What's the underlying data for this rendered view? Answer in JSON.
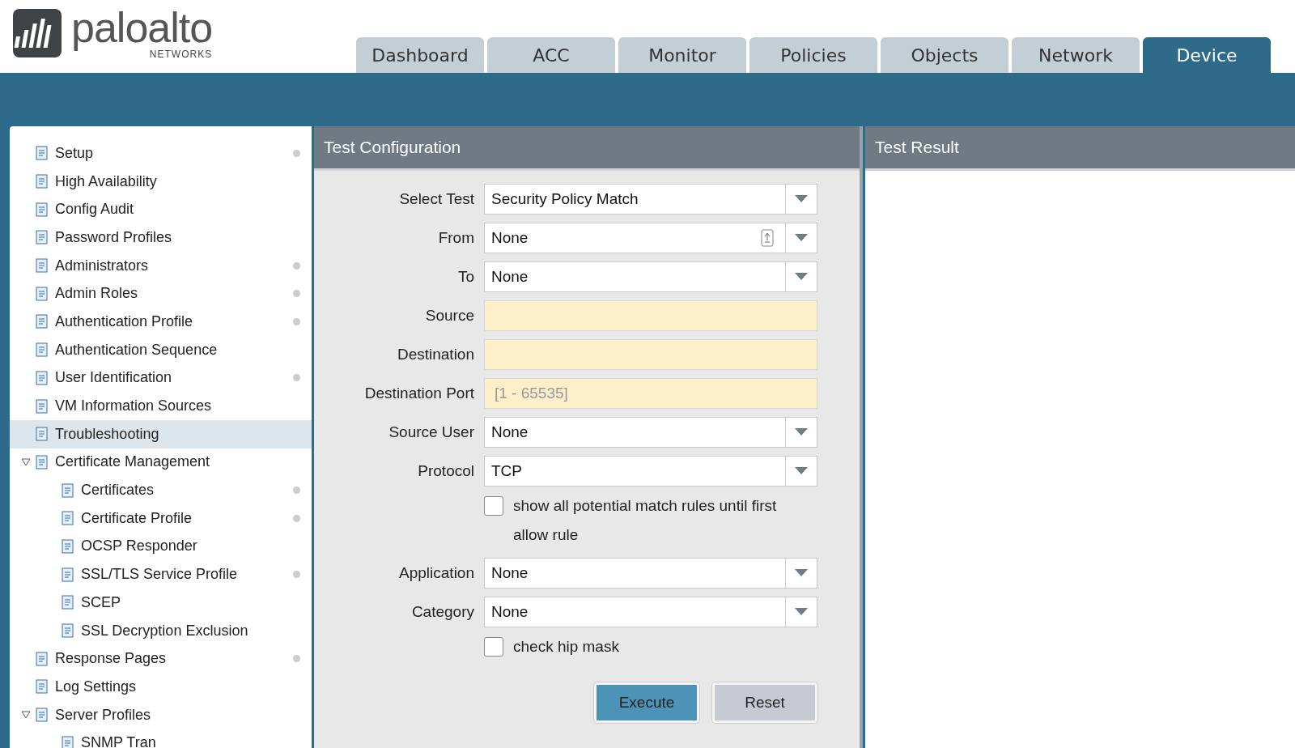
{
  "logo": {
    "wordmark": "paloalto",
    "subtitle": "NETWORKS"
  },
  "tabs": [
    {
      "label": "Dashboard",
      "selected": false
    },
    {
      "label": "ACC",
      "selected": false
    },
    {
      "label": "Monitor",
      "selected": false
    },
    {
      "label": "Policies",
      "selected": false
    },
    {
      "label": "Objects",
      "selected": false
    },
    {
      "label": "Network",
      "selected": false
    },
    {
      "label": "Device",
      "selected": true
    }
  ],
  "sidebar": {
    "items": [
      {
        "label": "Setup",
        "selected": false,
        "dot": true
      },
      {
        "label": "High Availability",
        "selected": false,
        "dot": false
      },
      {
        "label": "Config Audit",
        "selected": false,
        "dot": false
      },
      {
        "label": "Password Profiles",
        "selected": false,
        "dot": false
      },
      {
        "label": "Administrators",
        "selected": false,
        "dot": true
      },
      {
        "label": "Admin Roles",
        "selected": false,
        "dot": true
      },
      {
        "label": "Authentication Profile",
        "selected": false,
        "dot": true
      },
      {
        "label": "Authentication Sequence",
        "selected": false,
        "dot": false
      },
      {
        "label": "User Identification",
        "selected": false,
        "dot": true
      },
      {
        "label": "VM Information Sources",
        "selected": false,
        "dot": false
      },
      {
        "label": "Troubleshooting",
        "selected": true,
        "dot": false
      },
      {
        "label": "Certificate Management",
        "selected": false,
        "dot": false,
        "expanded": true,
        "children": [
          {
            "label": "Certificates",
            "selected": false,
            "dot": true
          },
          {
            "label": "Certificate Profile",
            "selected": false,
            "dot": true
          },
          {
            "label": "OCSP Responder",
            "selected": false,
            "dot": false
          },
          {
            "label": "SSL/TLS Service Profile",
            "selected": false,
            "dot": true
          },
          {
            "label": "SCEP",
            "selected": false,
            "dot": false
          },
          {
            "label": "SSL Decryption Exclusion",
            "selected": false,
            "dot": false
          }
        ]
      },
      {
        "label": "Response Pages",
        "selected": false,
        "dot": true
      },
      {
        "label": "Log Settings",
        "selected": false,
        "dot": false
      },
      {
        "label": "Server Profiles",
        "selected": false,
        "dot": false,
        "expanded": true,
        "children": [
          {
            "label": "SNMP Tran",
            "selected": false,
            "dot": false
          }
        ]
      }
    ]
  },
  "test_configuration": {
    "title": "Test Configuration",
    "fields": [
      {
        "kind": "select",
        "label": "Select Test",
        "value": "Security Policy Match",
        "picker": false
      },
      {
        "kind": "select",
        "label": "From",
        "value": "None",
        "picker": true
      },
      {
        "kind": "select",
        "label": "To",
        "value": "None",
        "picker": false
      },
      {
        "kind": "text",
        "label": "Source"
      },
      {
        "kind": "text",
        "label": "Destination"
      },
      {
        "kind": "text",
        "label": "Destination Port",
        "placeholder": "[1 - 65535]"
      },
      {
        "kind": "select",
        "label": "Source User",
        "value": "None",
        "picker": false
      },
      {
        "kind": "select",
        "label": "Protocol",
        "value": "TCP",
        "picker": false
      },
      {
        "kind": "checkbox",
        "label": "show all potential match rules until first allow rule",
        "checked": false
      },
      {
        "kind": "select",
        "label": "Application",
        "value": "None",
        "picker": false
      },
      {
        "kind": "select",
        "label": "Category",
        "value": "None",
        "picker": false
      },
      {
        "kind": "checkbox",
        "label": "check hip mask",
        "checked": false
      }
    ],
    "buttons": [
      {
        "label": "Execute",
        "primary": true
      },
      {
        "label": "Reset",
        "primary": false
      }
    ]
  },
  "test_result": {
    "title": "Test Result"
  }
}
